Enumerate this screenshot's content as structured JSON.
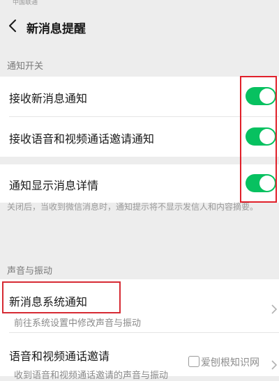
{
  "status_bar": {
    "carrier": "中国联通",
    "right": ""
  },
  "header": {
    "title": "新消息提醒"
  },
  "sections": {
    "notify_switch": {
      "header": "通知开关",
      "rows": [
        {
          "label": "接收新消息通知",
          "toggle_on": true
        },
        {
          "label": "接收语音和视频通话邀请通知",
          "toggle_on": true
        }
      ]
    },
    "details": {
      "row": {
        "label": "通知显示消息详情",
        "toggle_on": true
      },
      "hint": "关闭后，当收到微信消息时，通知提示将不显示发信人和内容摘要。"
    },
    "sound": {
      "header": "声音与振动",
      "rows": [
        {
          "label": "新消息系统通知",
          "sub": "前往系统设置中修改声音与振动"
        },
        {
          "label": "语音和视频通话邀请",
          "sub": "收到语音和视频通话邀请的声音与振动"
        }
      ]
    }
  },
  "watermark": "爱刨根知识网",
  "colors": {
    "toggle_on": "#07c160",
    "annotation_red": "#e0202a",
    "background": "#ededed"
  }
}
